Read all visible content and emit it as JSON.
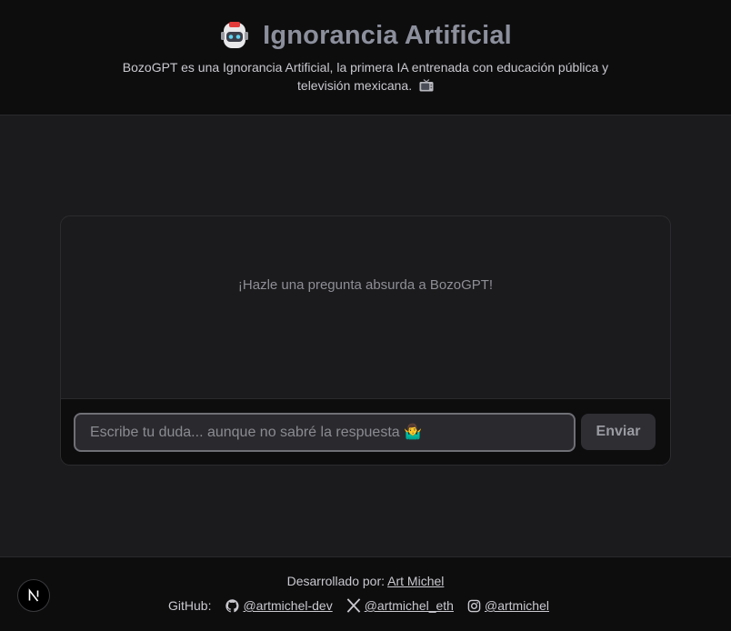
{
  "header": {
    "title": "Ignorancia Artificial",
    "subtitle": "BozoGPT es una Ignorancia Artificial, la primera IA entrenada con educación pública y televisión mexicana.",
    "logo_icon": "robot-icon",
    "tv_icon": "television-icon"
  },
  "chat": {
    "empty_message": "¡Hazle una pregunta absurda a BozoGPT!",
    "input_placeholder": "Escribe tu duda... aunque no sabré la respuesta 🤷‍♂️",
    "input_value": "",
    "send_label": "Enviar"
  },
  "footer": {
    "credit_prefix": "Desarrollado por:",
    "credit_name": "Art Michel",
    "github_label": "GitHub:",
    "links": [
      {
        "icon": "github-icon",
        "handle": "@artmichel-dev"
      },
      {
        "icon": "x-icon",
        "handle": "@artmichel_eth"
      },
      {
        "icon": "instagram-icon",
        "handle": "@artmichel"
      }
    ],
    "badge_letter": "N"
  },
  "colors": {
    "background": "#1b1b1d",
    "header_bg": "#0d0d0e",
    "title": "#8c8f9c",
    "button_bg": "#2e2e33"
  }
}
